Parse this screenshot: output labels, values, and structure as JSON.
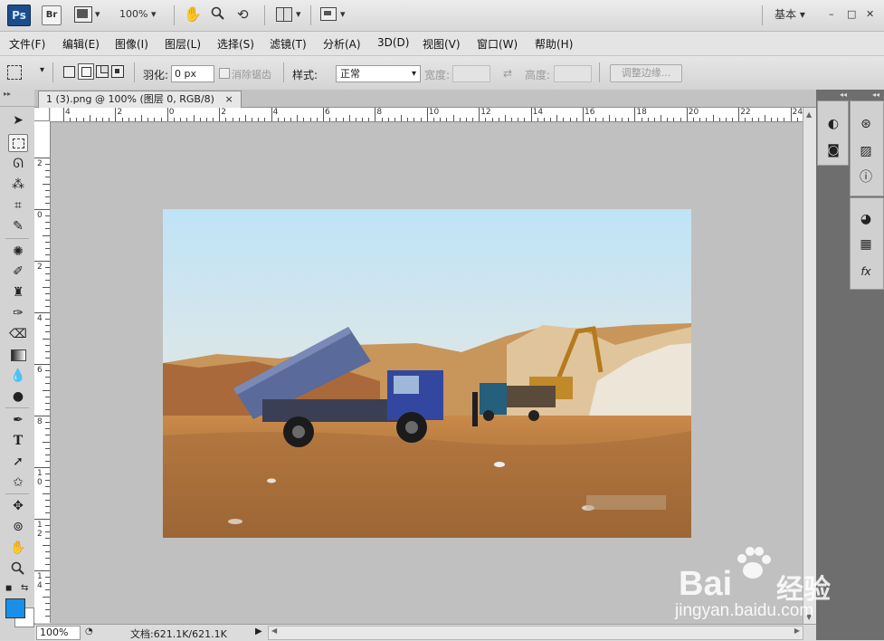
{
  "app": {
    "ps_badge": "Ps",
    "br_badge": "Br",
    "zoom_select": "100%",
    "workspace": "基本",
    "window_controls": [
      "–",
      "□",
      "✕"
    ]
  },
  "menu": [
    "文件(F)",
    "编辑(E)",
    "图像(I)",
    "图层(L)",
    "选择(S)",
    "滤镜(T)",
    "分析(A)",
    "3D(D)",
    "视图(V)",
    "窗口(W)",
    "帮助(H)"
  ],
  "options": {
    "feather_label": "羽化:",
    "feather_value": "0 px",
    "antialias_label": "消除锯齿",
    "style_label": "样式:",
    "style_value": "正常",
    "width_label": "宽度:",
    "height_label": "高度:",
    "refine_edge": "调整边缘..."
  },
  "document": {
    "tab_title": "1 (3).png @ 100% (图层 0, RGB/8)",
    "tab_close": "×"
  },
  "rulers": {
    "h_labels": [
      "4",
      "2",
      "0",
      "2",
      "4",
      "6",
      "8",
      "10",
      "12",
      "14",
      "16",
      "18",
      "20",
      "22",
      "24"
    ],
    "v_labels": [
      "2",
      "0",
      "2",
      "4",
      "6",
      "8",
      "1 0",
      "1 2",
      "1 4"
    ]
  },
  "status": {
    "zoom": "100%",
    "doc_info": "文档:621.1K/621.1K"
  },
  "watermark": {
    "brand": "Bai",
    "brand_cn": "经验",
    "url": "jingyan.baidu.com"
  },
  "colors": {
    "foreground": "#1a8fe8",
    "background": "#ffffff",
    "ps_blue": "#1b4d8c"
  },
  "tools": [
    "move-tool",
    "marquee-tool",
    "lasso-tool",
    "magic-wand-tool",
    "crop-tool",
    "eyedropper-tool",
    "spot-heal-tool",
    "brush-tool",
    "clone-stamp-tool",
    "history-brush-tool",
    "eraser-tool",
    "gradient-tool",
    "blur-tool",
    "dodge-tool",
    "pen-tool",
    "type-tool",
    "path-select-tool",
    "shape-tool",
    "3d-rotate-tool",
    "3d-orbit-tool",
    "hand-tool",
    "zoom-tool"
  ]
}
